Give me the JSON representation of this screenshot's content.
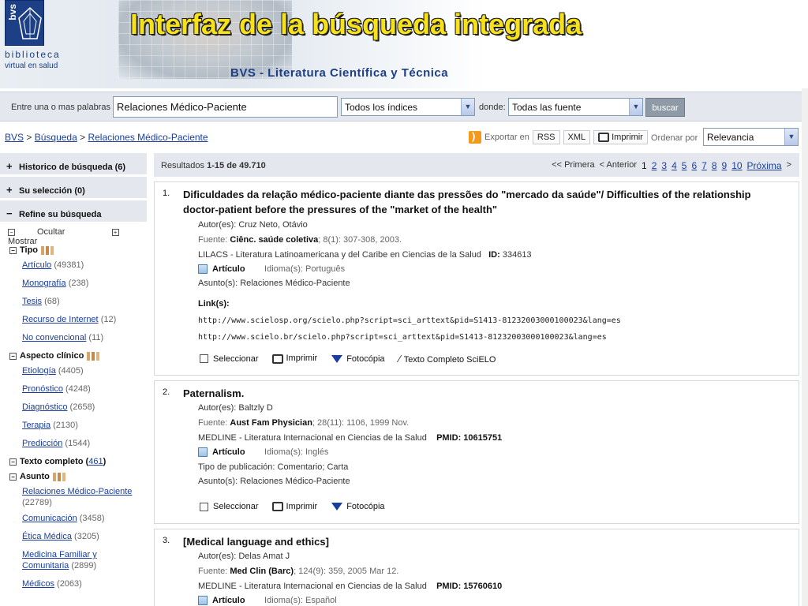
{
  "header": {
    "logo_vertical": "bvs",
    "logo_line1": "biblioteca",
    "logo_line2": "virtual en salud",
    "title": "Interfaz de la búsqueda integrada",
    "subtitle": "BVS - Literatura Científica y Técnica"
  },
  "search": {
    "label": "Entre una o mas palabras",
    "query": "Relaciones Médico-Paciente",
    "index_select": "Todos los índices",
    "donde_label": "donde:",
    "source_select": "Todas las fuente",
    "button": "buscar"
  },
  "breadcrumb": {
    "home": "BVS",
    "sep": ">",
    "search": "Búsqueda",
    "current": "Relaciones Médico-Paciente"
  },
  "export": {
    "label": "Exportar en",
    "rss": "RSS",
    "xml": "XML",
    "print": "Imprimir",
    "order_label": "Ordenar por",
    "order_value": "Relevancia"
  },
  "sidebar": {
    "history": "Historico de búsqueda",
    "history_count": "(6)",
    "selection": "Su selección",
    "selection_count": "(0)",
    "refine": "Refine su búsqueda",
    "hide": "Ocultar",
    "show": "Mostrar",
    "facets": {
      "tipo": {
        "title": "Tipo",
        "items": [
          {
            "label": "Artículo",
            "count": "(49381)"
          },
          {
            "label": "Monografía",
            "count": "(238)"
          },
          {
            "label": "Tesis",
            "count": "(68)"
          },
          {
            "label": "Recurso de Internet",
            "count": "(12)"
          },
          {
            "label": "No convencional",
            "count": "(11)"
          }
        ]
      },
      "aspecto": {
        "title": "Aspecto clínico",
        "items": [
          {
            "label": "Etiología",
            "count": "(4405)"
          },
          {
            "label": "Pronóstico",
            "count": "(4248)"
          },
          {
            "label": "Diagnóstico",
            "count": "(2658)"
          },
          {
            "label": "Terapia",
            "count": "(2130)"
          },
          {
            "label": "Predicción",
            "count": "(1544)"
          }
        ]
      },
      "texto_completo": {
        "title": "Texto completo",
        "open": "(",
        "count": "461",
        "close": ")"
      },
      "asunto": {
        "title": "Asunto",
        "items": [
          {
            "label": "Relaciones Médico-Paciente",
            "count": "(22789)"
          },
          {
            "label": "Comunicación",
            "count": "(3458)"
          },
          {
            "label": "Ética Médica",
            "count": "(3205)"
          },
          {
            "label": "Medicina Familiar y Comunitaria",
            "count": "(2899)"
          },
          {
            "label": "Médicos",
            "count": "(2063)"
          }
        ]
      }
    }
  },
  "results": {
    "label": "Resultados",
    "range": "1-15",
    "of": "de",
    "total": "49.710",
    "pager": {
      "first": "<< Primera",
      "prev": "< Anterior",
      "current": "1",
      "pages": [
        "2",
        "3",
        "4",
        "5",
        "6",
        "7",
        "8",
        "9",
        "10"
      ],
      "next": "Próxima",
      "next_arrow": ">"
    },
    "items": [
      {
        "num": "1.",
        "title": "Dificuldades da relação médico-paciente diante das pressões do \"mercado da saúde\"/ Difficulties of the relationship doctor-patient before the pressures of the \"market of the health\"",
        "author_label": "Autor(es):",
        "author": "Cruz Neto, Otávio",
        "source_label": "Fuente:",
        "source_journal": "Ciênc. saúde coletiva",
        "source_rest": "; 8(1): 307-308, 2003.",
        "db": "LILACS - Literatura Latinoamericana y del Caribe en Ciencias de la Salud",
        "id_label": "ID:",
        "id": "334613",
        "type": "Artículo",
        "lang_label": "Idioma(s):",
        "lang": "Português",
        "subject_label": "Asunto(s):",
        "subject": "Relaciones Médico-Paciente",
        "links_label": "Link(s):",
        "links": [
          "http://www.scielosp.org/scielo.php?script=sci_arttext&pid=S1413-81232003000100023&lang=es",
          "http://www.scielo.br/scielo.php?script=sci_arttext&pid=S1413-81232003000100023&lang=es"
        ],
        "actions": [
          "Seleccionar",
          "Imprimir",
          "Fotocópia",
          "Texto Completo SciELO"
        ]
      },
      {
        "num": "2.",
        "title": "Paternalism.",
        "author_label": "Autor(es):",
        "author": "Baltzly D",
        "source_label": "Fuente:",
        "source_journal": "Aust Fam Physician",
        "source_rest": "; 28(11): 1106, 1999 Nov.",
        "db": "MEDLINE - Literatura Internacional en Ciencias de la Salud",
        "id_label": "PMID:",
        "id": "10615751",
        "type": "Artículo",
        "lang_label": "Idioma(s):",
        "lang": "Inglés",
        "pubtype_label": "Tipo de publicación:",
        "pubtype": "Comentario; Carta",
        "subject_label": "Asunto(s):",
        "subject": "Relaciones Médico-Paciente",
        "actions": [
          "Seleccionar",
          "Imprimir",
          "Fotocópia"
        ]
      },
      {
        "num": "3.",
        "title": "[Medical language and ethics]",
        "author_label": "Autor(es):",
        "author": "Delas Amat J",
        "source_label": "Fuente:",
        "source_journal": "Med Clin (Barc)",
        "source_rest": "; 124(9): 359, 2005 Mar 12.",
        "db": "MEDLINE - Literatura Internacional en Ciencias de la Salud",
        "id_label": "PMID:",
        "id": "15760610",
        "type": "Artículo",
        "lang_label": "Idioma(s):",
        "lang": "Español"
      }
    ]
  },
  "colors": {
    "link": "#1a3e9e",
    "title_yellow": "#f7e21a",
    "panel_bg": "#e4e8ee",
    "brand_blue": "#1c3f86"
  }
}
